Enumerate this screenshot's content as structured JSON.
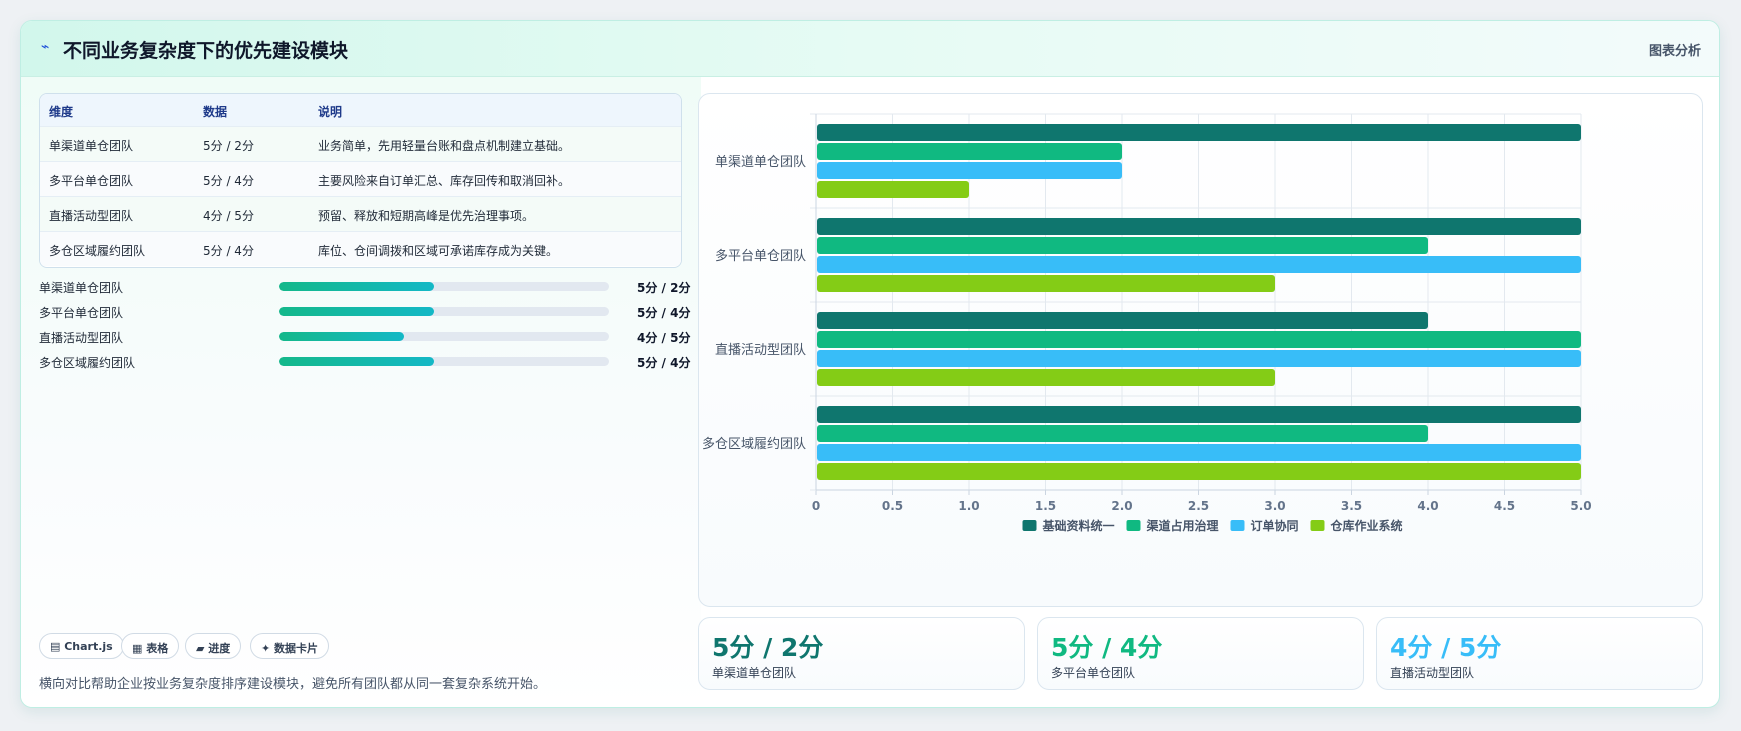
{
  "header": {
    "title": "不同业务复杂度下的优先建设模块",
    "link_label": "图表分析",
    "icon": "lightning-icon"
  },
  "table": {
    "columns": [
      "维度",
      "数据",
      "说明"
    ],
    "rows": [
      {
        "dim": "单渠道单仓团队",
        "data": "5分 / 2分",
        "desc": "业务简单，先用轻量台账和盘点机制建立基础。"
      },
      {
        "dim": "多平台单仓团队",
        "data": "5分 / 4分",
        "desc": "主要风险来自订单汇总、库存回传和取消回补。"
      },
      {
        "dim": "直播活动型团队",
        "data": "4分 / 5分",
        "desc": "预留、释放和短期高峰是优先治理事项。"
      },
      {
        "dim": "多仓区域履约团队",
        "data": "5分 / 4分",
        "desc": "库位、仓间调拨和区域可承诺库存成为关键。"
      }
    ]
  },
  "progress": [
    {
      "label": "单渠道单仓团队",
      "value_text": "5分 / 2分",
      "fraction": 0.47
    },
    {
      "label": "多平台单仓团队",
      "value_text": "5分 / 4分",
      "fraction": 0.47
    },
    {
      "label": "直播活动型团队",
      "value_text": "4分 / 5分",
      "fraction": 0.38
    },
    {
      "label": "多仓区域履约团队",
      "value_text": "5分 / 4分",
      "fraction": 0.47
    }
  ],
  "chips": [
    {
      "label": "▤ Chart.js",
      "icon": "chart-icon"
    },
    {
      "label": "▦ 表格",
      "icon": "table-icon"
    },
    {
      "label": "▰ 进度",
      "icon": "progress-icon"
    },
    {
      "label": "✦ 数据卡片",
      "icon": "sparkle-icon"
    }
  ],
  "footer_text": "横向对比帮助企业按业务复杂度排序建设模块，避免所有团队都从同一套复杂系统开始。",
  "kpis": [
    {
      "value": "5分 / 2分",
      "label": "单渠道单仓团队",
      "color": "#0f766e"
    },
    {
      "value": "5分 / 4分",
      "label": "多平台单仓团队",
      "color": "#10b981"
    },
    {
      "value": "4分 / 5分",
      "label": "直播活动型团队",
      "color": "#38bdf8"
    }
  ],
  "chart_data": {
    "type": "bar",
    "orientation": "horizontal",
    "categories": [
      "单渠道单仓团队",
      "多平台单仓团队",
      "直播活动型团队",
      "多仓区域履约团队"
    ],
    "series": [
      {
        "name": "基础资料统一",
        "color": "#0f766e",
        "values": [
          5,
          5,
          4,
          5
        ]
      },
      {
        "name": "渠道占用治理",
        "color": "#10b981",
        "values": [
          2,
          4,
          5,
          4
        ]
      },
      {
        "name": "订单协同",
        "color": "#38bdf8",
        "values": [
          2,
          5,
          5,
          5
        ]
      },
      {
        "name": "仓库作业系统",
        "color": "#84cc16",
        "values": [
          1,
          3,
          3,
          5
        ]
      }
    ],
    "xlim": [
      0,
      5
    ],
    "xticks": [
      "0",
      "0.5",
      "1.0",
      "1.5",
      "2.0",
      "2.5",
      "3.0",
      "3.5",
      "4.0",
      "4.5",
      "5.0"
    ],
    "grid": true,
    "legend_position": "bottom"
  }
}
